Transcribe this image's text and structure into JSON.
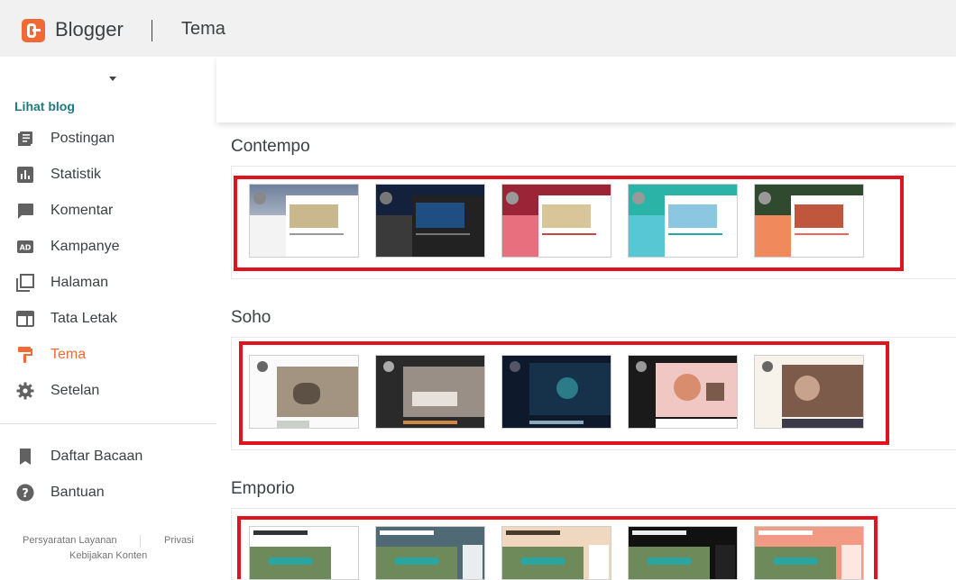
{
  "header": {
    "brand": "Blogger",
    "section": "Tema"
  },
  "sidebar": {
    "view_blog": "Lihat blog",
    "items": [
      {
        "label": "Postingan",
        "icon": "posts-icon"
      },
      {
        "label": "Statistik",
        "icon": "stats-icon"
      },
      {
        "label": "Komentar",
        "icon": "comment-icon"
      },
      {
        "label": "Kampanye",
        "icon": "ads-icon"
      },
      {
        "label": "Halaman",
        "icon": "pages-icon"
      },
      {
        "label": "Tata Letak",
        "icon": "layout-icon"
      },
      {
        "label": "Tema",
        "icon": "theme-icon",
        "active": true
      },
      {
        "label": "Setelan",
        "icon": "gear-icon"
      }
    ],
    "bottom_items": [
      {
        "label": "Daftar Bacaan",
        "icon": "bookmark-icon"
      },
      {
        "label": "Bantuan",
        "icon": "help-icon"
      }
    ],
    "footer": {
      "terms": "Persyaratan Layanan",
      "privacy": "Privasi",
      "content_policy": "Kebijakan Konten"
    }
  },
  "themes": [
    {
      "name": "Contempo",
      "variants": 5
    },
    {
      "name": "Soho",
      "variants": 5
    },
    {
      "name": "Emporio",
      "variants": 5
    }
  ],
  "colors": {
    "accent": "#f06a35",
    "link": "#1e7a80",
    "highlight": "#e0141e"
  }
}
